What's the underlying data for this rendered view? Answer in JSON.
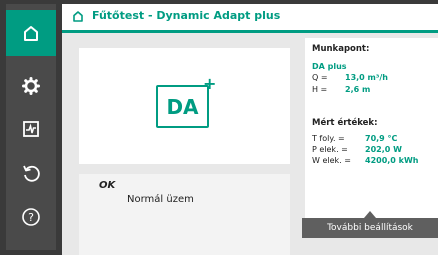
{
  "colors": {
    "accent": "#009c82",
    "sidebar": "#4a4a4a",
    "frame": "#3a3a3a"
  },
  "header": {
    "title": "Fűtőtest - Dynamic Adapt plus",
    "icon": "home-icon"
  },
  "sidebar": {
    "items": [
      {
        "name": "home",
        "icon": "home-icon",
        "active": true
      },
      {
        "name": "settings",
        "icon": "gear-icon",
        "active": false
      },
      {
        "name": "diagnostics",
        "icon": "monitor-icon",
        "active": false
      },
      {
        "name": "restore",
        "icon": "undo-icon",
        "active": false
      },
      {
        "name": "help",
        "icon": "help-icon",
        "active": false
      }
    ]
  },
  "logo": {
    "text": "DA",
    "plus": "+"
  },
  "status": {
    "code": "OK",
    "text": "Normál üzem"
  },
  "info": {
    "operating_point_title": "Munkapont:",
    "mode": "DA plus",
    "q_label": "Q =",
    "q_value": "13,0 m³/h",
    "h_label": "H =",
    "h_value": "2,6 m",
    "measured_title": "Mért értékek:",
    "t_label": "T foly. =",
    "t_value": "70,9 °C",
    "p_label": "P elek. =",
    "p_value": "202,0 W",
    "w_label": "W elek. =",
    "w_value": "4200,0 kWh"
  },
  "more_settings": "További beállítások"
}
